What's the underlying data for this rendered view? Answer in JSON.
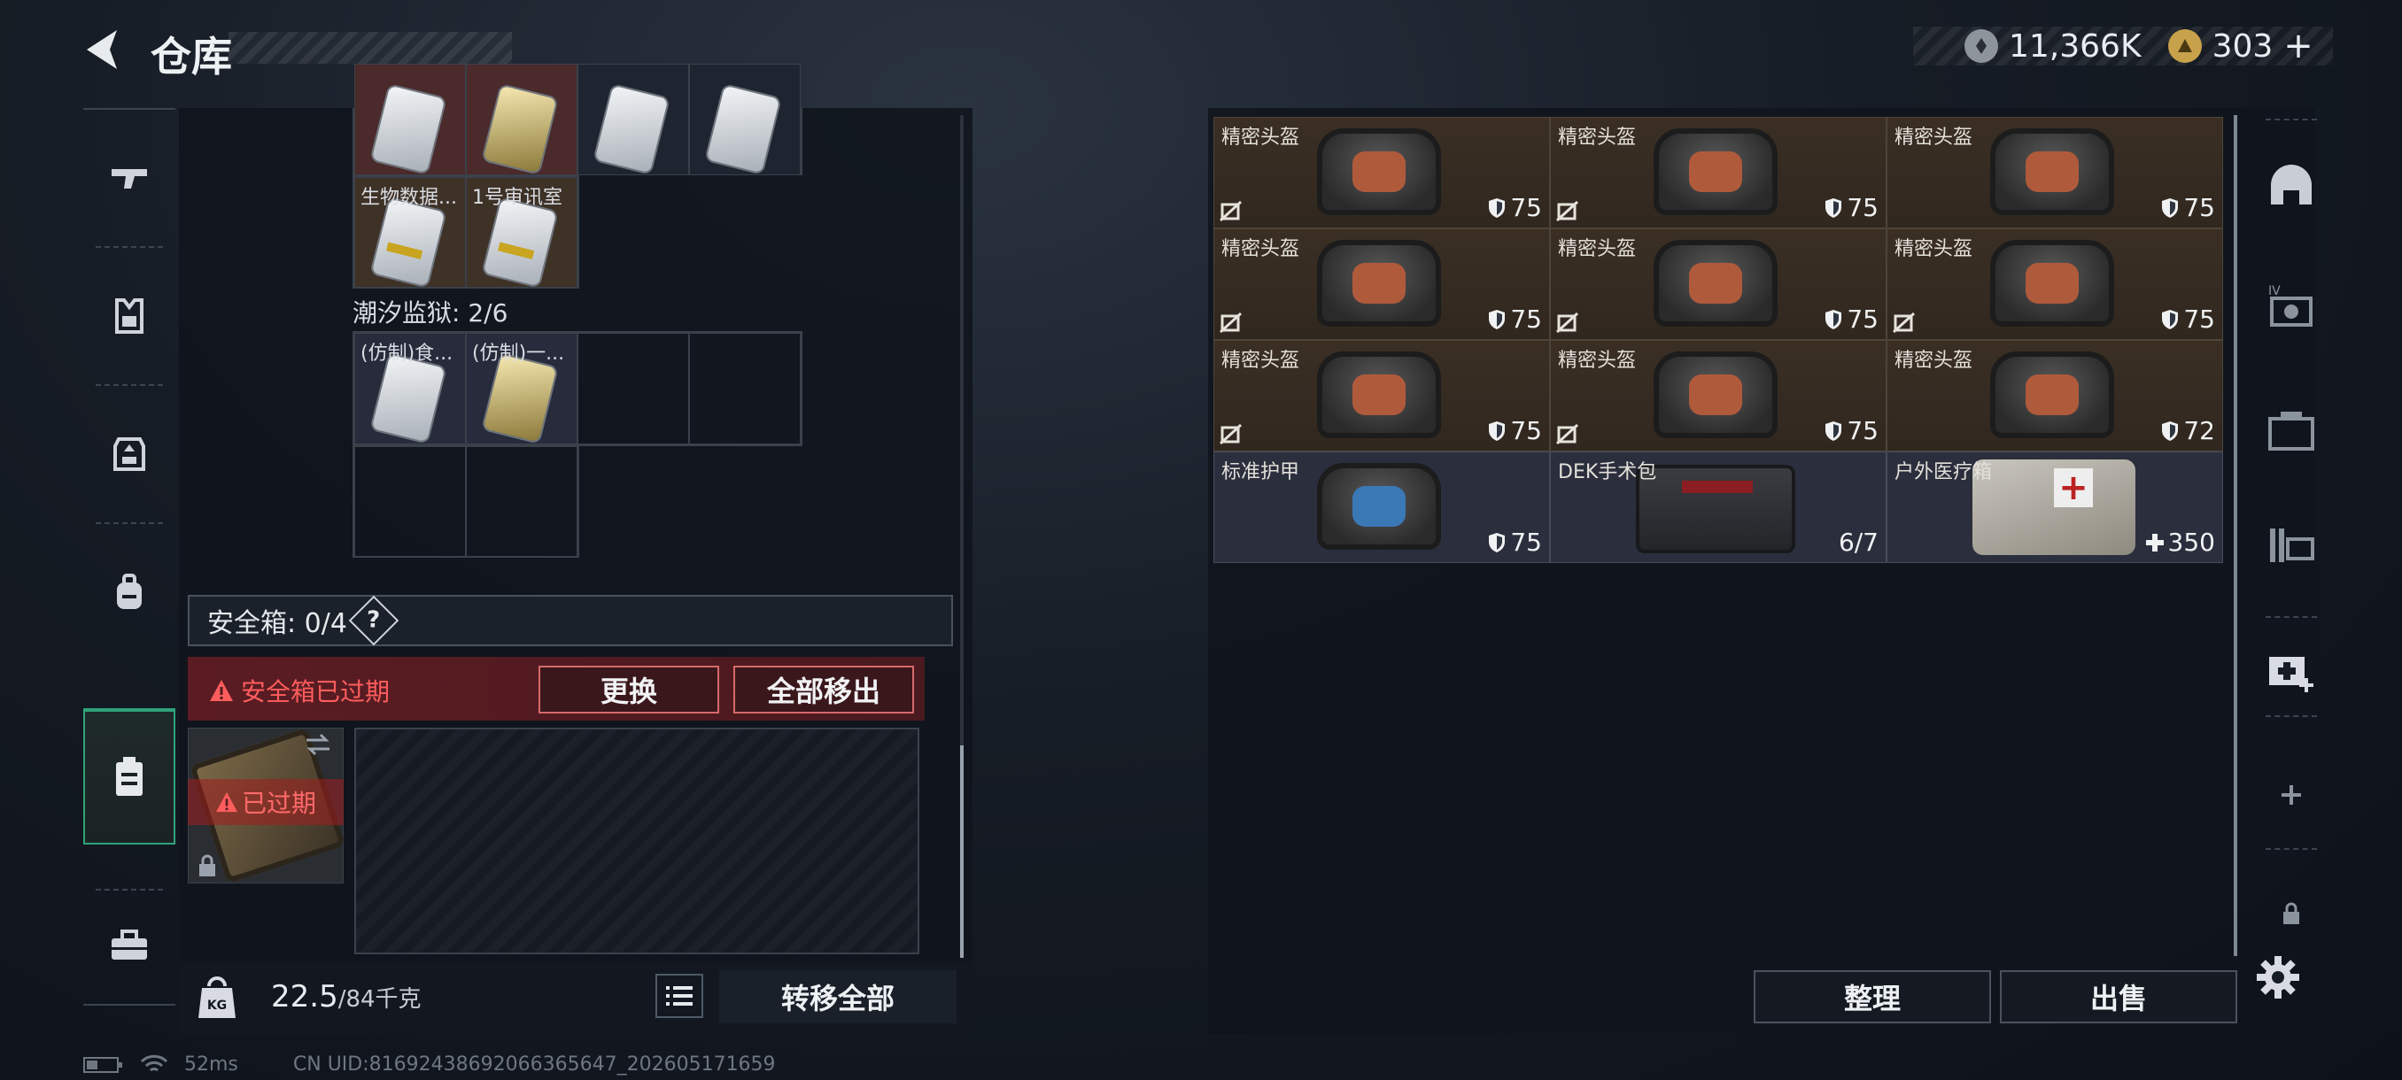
{
  "header": {
    "title": "仓库"
  },
  "currency": {
    "primary_value": "11,366K",
    "secondary_value": "303",
    "add_label": "+"
  },
  "left_rail": {
    "items": [
      "weapon",
      "armor",
      "chest-rig",
      "backpack",
      "safe-box",
      "toolbox"
    ],
    "active": "safe-box"
  },
  "left_panel": {
    "top_cells": [
      {
        "label": "生物数据...",
        "card": "white"
      },
      {
        "label": "1号审讯室",
        "card": "white"
      }
    ],
    "prison_label": "潮汐监狱: 2/6",
    "prison_cells": [
      {
        "label": "(仿制)食...",
        "card": "white"
      },
      {
        "label": "(仿制)一...",
        "card": "gold"
      }
    ],
    "safe_box": {
      "label": "安全箱: 0/4",
      "help": "?"
    },
    "expired_text": "安全箱已过期",
    "replace_label": "更换",
    "move_all_out_label": "全部移出",
    "case_expired_label": "已过期",
    "weight": {
      "current": "22.5",
      "max": "/84千克"
    },
    "transfer_all_label": "转移全部"
  },
  "right_panel": {
    "items": [
      {
        "label": "精密头盔",
        "value": "75",
        "kind": "helmet",
        "bg": "brown",
        "no_trade": true
      },
      {
        "label": "精密头盔",
        "value": "75",
        "kind": "helmet",
        "bg": "brown",
        "no_trade": true
      },
      {
        "label": "精密头盔",
        "value": "75",
        "kind": "helmet",
        "bg": "brown",
        "no_trade": false
      },
      {
        "label": "精密头盔",
        "value": "75",
        "kind": "helmet",
        "bg": "brown",
        "no_trade": true
      },
      {
        "label": "精密头盔",
        "value": "75",
        "kind": "helmet",
        "bg": "brown",
        "no_trade": true
      },
      {
        "label": "精密头盔",
        "value": "75",
        "kind": "helmet",
        "bg": "brown",
        "no_trade": true
      },
      {
        "label": "精密头盔",
        "value": "75",
        "kind": "helmet",
        "bg": "brown",
        "no_trade": true
      },
      {
        "label": "精密头盔",
        "value": "75",
        "kind": "helmet",
        "bg": "brown",
        "no_trade": true
      },
      {
        "label": "精密头盔",
        "value": "72",
        "kind": "helmet",
        "bg": "brown",
        "no_trade": false
      },
      {
        "label": "标准护甲",
        "value": "75",
        "kind": "vest",
        "bg": "blue",
        "no_trade": false
      },
      {
        "label": "DEK手术包",
        "value": "6/7",
        "kind": "pouch",
        "bg": "blue",
        "no_trade": false
      },
      {
        "label": "户外医疗箱",
        "value": "350",
        "kind": "medkit",
        "bg": "blue",
        "no_trade": false
      }
    ],
    "sort_label": "整理",
    "sell_label": "出售"
  },
  "right_rail": {
    "items": [
      "helmet-slot",
      "ivs-slot",
      "case-slot",
      "rack-slot",
      "medical-add",
      "add",
      "lock"
    ]
  },
  "status": {
    "ping": "52ms",
    "uid": "CN UID:8169243869206636564​7_202605171659"
  },
  "colors": {
    "accent_green": "#2fa37a",
    "danger_red": "#ff5d5d",
    "brown_cell": "#3b2f24",
    "blue_cell": "#2b2f3d"
  }
}
